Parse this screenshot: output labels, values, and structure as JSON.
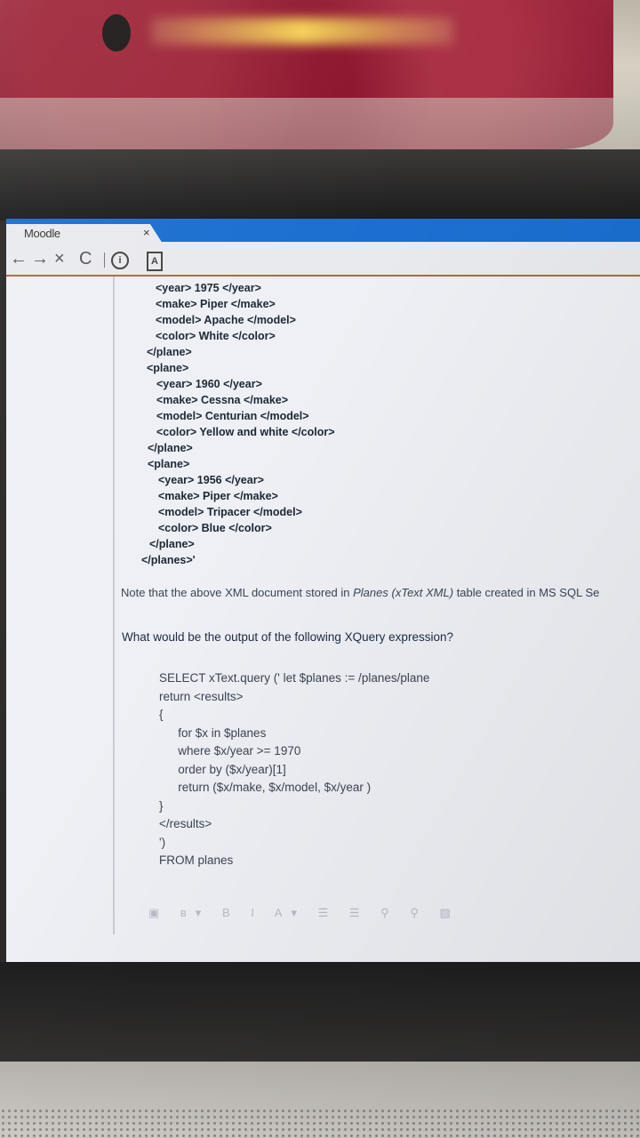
{
  "browser": {
    "tab_title": "Moodle",
    "tab_close": "×",
    "nav": {
      "back": "←",
      "forward": "→",
      "stop": "×",
      "reload": "C",
      "info": "i",
      "page": "A"
    }
  },
  "xml_lines": [
    "<year> 1975 </year>",
    "<make> Piper </make>",
    "<model> Apache </model>",
    "<color> White </color>",
    "</plane>",
    "<plane>",
    "<year> 1960 </year>",
    "<make> Cessna </make>",
    "<model> Centurian </model>",
    "<color> Yellow and white </color>",
    "</plane>",
    "<plane>",
    "<year> 1956 </year>",
    "<make> Piper </make>",
    "<model> Tripacer </model>",
    "<color> Blue </color>",
    "</plane>",
    "</planes>'"
  ],
  "note": {
    "prefix": "Note that the above XML document stored in ",
    "italic": "Planes (xText  XML)",
    "suffix": " table created in MS SQL Se"
  },
  "question": "What would be the output of the following XQuery expression?",
  "code_lines": [
    "SELECT xText.query (' let $planes := /planes/plane",
    "return <results>",
    "{",
    "   for $x in $planes",
    "   where $x/year >= 1970",
    "   order by ($x/year)[1]",
    "   return ($x/make, $x/model, $x/year )",
    "}",
    "</results>",
    "')",
    "FROM planes"
  ]
}
